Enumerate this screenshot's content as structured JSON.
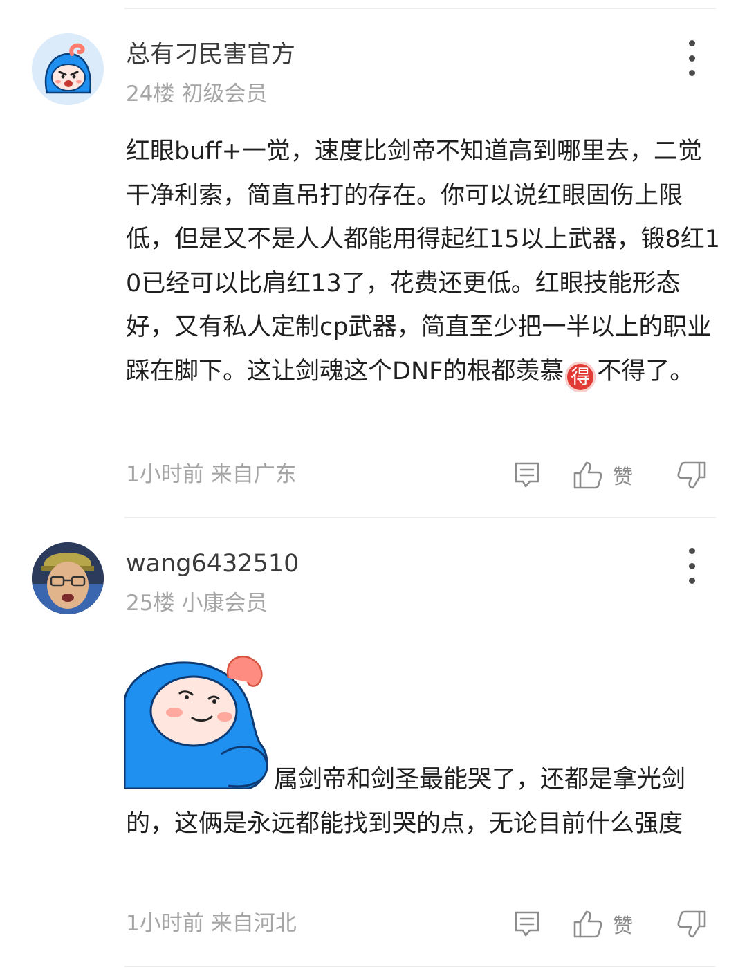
{
  "posts": [
    {
      "username": "总有刁民害官方",
      "floor": "24楼",
      "level": "初级会员",
      "content": "红眼buff+一觉，速度比剑帝不知道高到哪里去，二觉干净利索，简直吊打的存在。你可以说红眼固伤上限低，但是又不是人人都能用得起红15以上武器，锻8红10已经可以比肩红13了，花费还更低。红眼技能形态好，又有私人定制cp武器，简直至少把一半以上的职业踩在脚下。这让剑魂这个DNF的根都羡慕",
      "emoji_glyph": "得",
      "content_tail": "不得了。",
      "time": "1小时前",
      "location": "来自广东",
      "like_label": "赞"
    },
    {
      "username": "wang6432510",
      "floor": "25楼",
      "level": "小康会员",
      "content": "属剑帝和剑圣最能哭了，还都是拿光剑的，这俩是永远都能找到哭的点，无论目前什么强度",
      "time": "1小时前",
      "location": "来自河北",
      "like_label": "赞"
    }
  ],
  "colors": {
    "username": "#3a3a3a",
    "meta": "#a5a5a5",
    "text": "#1f1f1f",
    "icon": "#8c8c8c",
    "divider": "#ededed",
    "mascot_blue": "#1f8ff0",
    "mascot_pink": "#ff8a80"
  },
  "icons": [
    "more-vertical-icon",
    "comment-icon",
    "thumb-up-icon",
    "thumb-down-icon",
    "emoji-de-icon"
  ]
}
